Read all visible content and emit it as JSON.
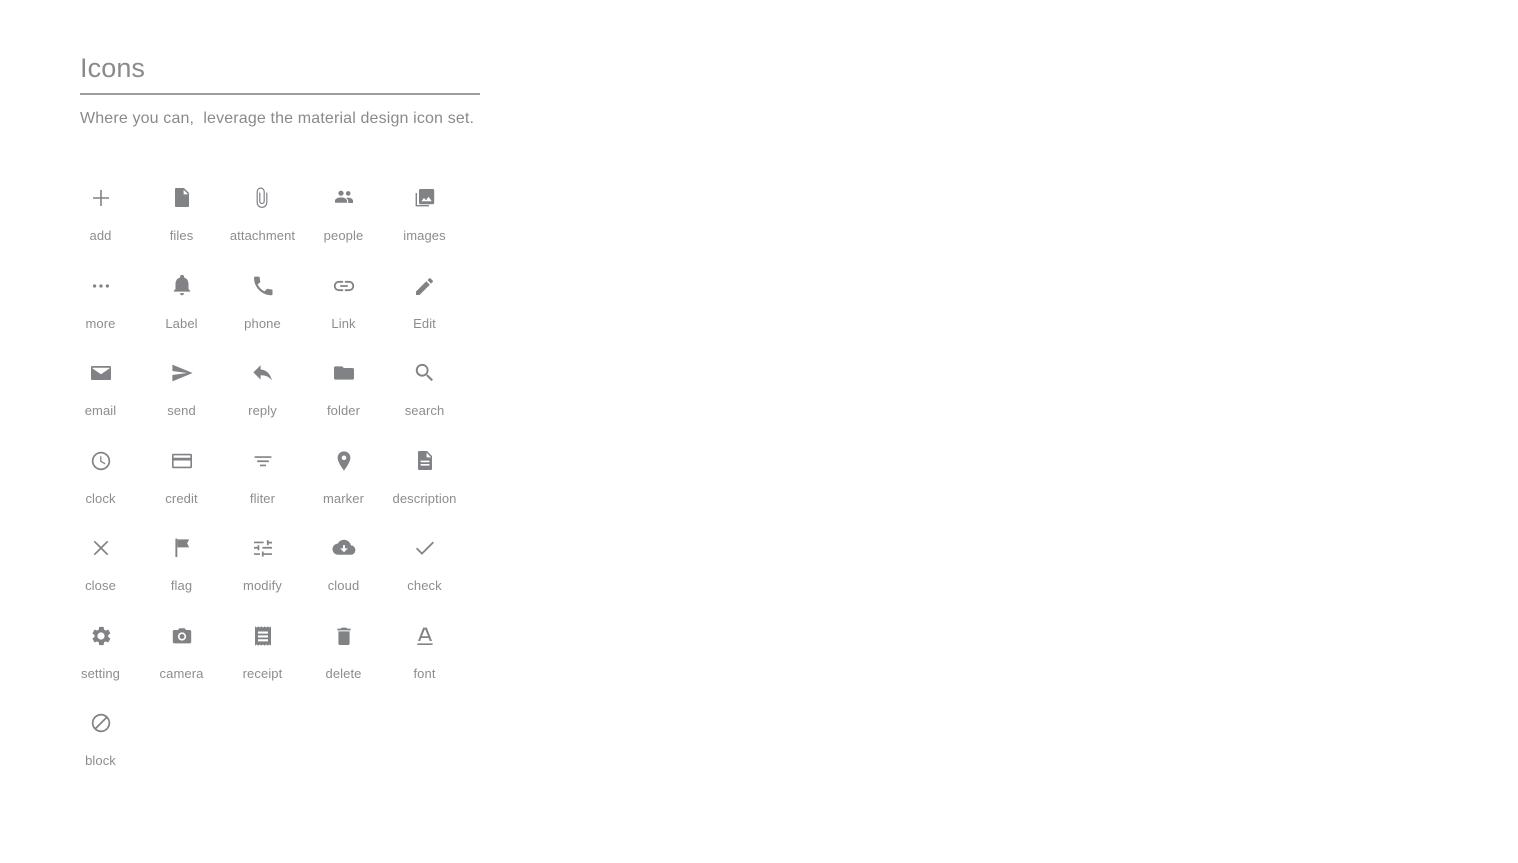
{
  "header": {
    "title": "Icons",
    "subtitle": "Where you can,  leverage the material design icon set."
  },
  "colors": {
    "icon": "#808285",
    "label": "#8d8d8d",
    "title": "#8a8a8a",
    "rule": "#9e9e9e",
    "background": "#ffffff"
  },
  "icons": [
    {
      "label": "add",
      "icon": "add-icon"
    },
    {
      "label": "files",
      "icon": "files-icon"
    },
    {
      "label": "attachment",
      "icon": "attachment-icon"
    },
    {
      "label": "people",
      "icon": "people-icon"
    },
    {
      "label": "images",
      "icon": "images-icon"
    },
    {
      "label": "more",
      "icon": "more-icon"
    },
    {
      "label": "Label",
      "icon": "label-bell-icon"
    },
    {
      "label": "phone",
      "icon": "phone-icon"
    },
    {
      "label": "Link",
      "icon": "link-icon"
    },
    {
      "label": "Edit",
      "icon": "edit-pencil-icon"
    },
    {
      "label": "email",
      "icon": "email-icon"
    },
    {
      "label": "send",
      "icon": "send-icon"
    },
    {
      "label": "reply",
      "icon": "reply-icon"
    },
    {
      "label": "folder",
      "icon": "folder-icon"
    },
    {
      "label": "search",
      "icon": "search-icon"
    },
    {
      "label": "clock",
      "icon": "clock-icon"
    },
    {
      "label": "credit",
      "icon": "credit-card-icon"
    },
    {
      "label": "fliter",
      "icon": "filter-icon"
    },
    {
      "label": "marker",
      "icon": "marker-pin-icon"
    },
    {
      "label": "description",
      "icon": "description-icon"
    },
    {
      "label": "close",
      "icon": "close-icon"
    },
    {
      "label": "flag",
      "icon": "flag-icon"
    },
    {
      "label": "modify",
      "icon": "modify-tune-icon"
    },
    {
      "label": "cloud",
      "icon": "cloud-download-icon"
    },
    {
      "label": "check",
      "icon": "check-icon"
    },
    {
      "label": "setting",
      "icon": "setting-gear-icon"
    },
    {
      "label": "camera",
      "icon": "camera-icon"
    },
    {
      "label": "receipt",
      "icon": "receipt-icon"
    },
    {
      "label": "delete",
      "icon": "delete-trash-icon"
    },
    {
      "label": "font",
      "icon": "font-format-icon"
    },
    {
      "label": "block",
      "icon": "block-icon"
    }
  ]
}
